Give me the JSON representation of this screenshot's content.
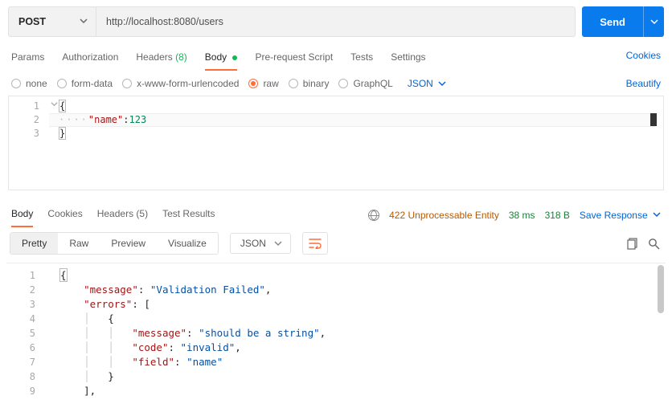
{
  "request": {
    "method": "POST",
    "url": "http://localhost:8080/users",
    "send_label": "Send"
  },
  "req_tabs": {
    "params": "Params",
    "authorization": "Authorization",
    "headers_label": "Headers",
    "headers_count": "(8)",
    "body": "Body",
    "prerequest": "Pre-request Script",
    "tests": "Tests",
    "settings": "Settings",
    "cookies": "Cookies"
  },
  "body_type": {
    "none": "none",
    "formdata": "form-data",
    "xwww": "x-www-form-urlencoded",
    "raw": "raw",
    "binary": "binary",
    "graphql": "GraphQL",
    "raw_lang": "JSON",
    "beautify": "Beautify"
  },
  "request_body": {
    "lines": [
      "1",
      "2",
      "3"
    ],
    "l1": "{",
    "l2_dots": "····",
    "l2_key": "\"name\"",
    "l2_colon": ":",
    "l2_val": "123",
    "l3": "}"
  },
  "resp_tabs": {
    "body": "Body",
    "cookies": "Cookies",
    "headers_label": "Headers",
    "headers_count": "(5)",
    "testresults": "Test Results"
  },
  "response_meta": {
    "status": "422 Unprocessable Entity",
    "time": "38 ms",
    "size": "318 B",
    "save": "Save Response"
  },
  "view_modes": {
    "pretty": "Pretty",
    "raw": "Raw",
    "preview": "Preview",
    "visualize": "Visualize",
    "lang": "JSON"
  },
  "response_body": {
    "lines": [
      "1",
      "2",
      "3",
      "4",
      "5",
      "6",
      "7",
      "8",
      "9"
    ],
    "k_message": "\"message\"",
    "v_message": "\"Validation Failed\"",
    "k_errors": "\"errors\"",
    "k_msg2": "\"message\"",
    "v_msg2": "\"should be a string\"",
    "k_code": "\"code\"",
    "v_code": "\"invalid\"",
    "k_field": "\"field\"",
    "v_field": "\"name\"",
    "brace_open": "{",
    "brace_close": "}",
    "bracket_open": "[",
    "bracket_close_comma": "],",
    "colon_sp": ": ",
    "comma": ","
  },
  "chart_data": {
    "type": "table",
    "note": "JSON response body parsed",
    "value": {
      "message": "Validation Failed",
      "errors": [
        {
          "message": "should be a string",
          "code": "invalid",
          "field": "name"
        }
      ]
    }
  }
}
